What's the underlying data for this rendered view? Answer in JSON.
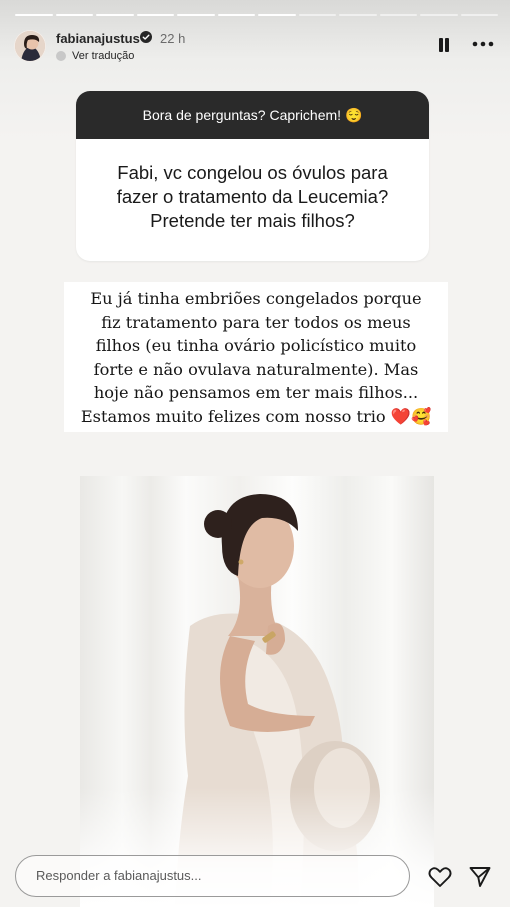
{
  "story": {
    "segments": 12,
    "current_segment": 7
  },
  "header": {
    "username": "fabianajustus",
    "time": "22 h",
    "translate": "Ver tradução"
  },
  "question_card": {
    "title": "Bora de perguntas? Caprichem! 😌",
    "question": "Fabi, vc congelou os óvulos para fazer o tratamento da Leucemia? Pretende ter mais filhos?"
  },
  "answer": {
    "lines": [
      "Eu já tinha embriões congelados porque",
      "fiz tratamento para ter todos os meus",
      "filhos (eu tinha ovário policístico muito",
      "forte e não ovulava naturalmente). Mas",
      "hoje não pensamos em ter mais filhos...",
      "Estamos muito felizes com nosso trio ❤️🥰"
    ]
  },
  "reply": {
    "placeholder": "Responder a fabianajustus..."
  },
  "icons": {
    "verified": "verified-badge-icon",
    "pause": "pause-icon",
    "more": "more-options-icon",
    "like": "heart-icon",
    "send": "send-icon"
  },
  "colors": {
    "question_header_bg": "#2a2a2a",
    "text": "#1a1a1a",
    "verified": "#262626"
  }
}
